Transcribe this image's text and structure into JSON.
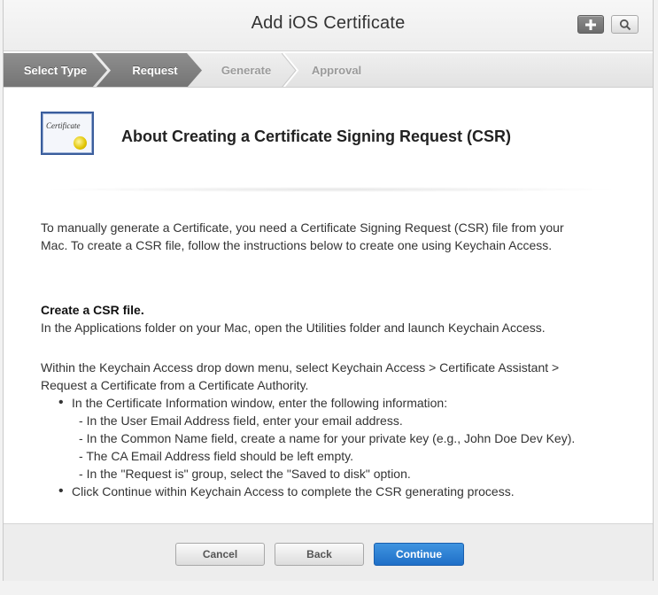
{
  "window": {
    "title": "Add iOS Certificate"
  },
  "toolbar": {
    "add_icon": "plus-icon",
    "search_icon": "search-icon"
  },
  "steps": [
    {
      "label": "Select Type",
      "state": "complete"
    },
    {
      "label": "Request",
      "state": "current"
    },
    {
      "label": "Generate",
      "state": "upcoming"
    },
    {
      "label": "Approval",
      "state": "upcoming"
    }
  ],
  "header": {
    "image_text": "Certificate",
    "title": "About Creating a Certificate Signing Request (CSR)"
  },
  "content": {
    "intro_1": "To manually generate a Certificate, you need a Certificate Signing Request (CSR) file from your",
    "intro_2": "Mac. To create a CSR file, follow the instructions below to create one using Keychain Access.",
    "section_title": "Create a CSR file.",
    "section_text": "In the Applications folder on your Mac, open the Utilities folder and launch Keychain Access.",
    "menu_text_1": "Within the Keychain Access drop down menu, select Keychain Access > Certificate Assistant >",
    "menu_text_2": "Request a Certificate from a Certificate Authority.",
    "bullet_1": "In the Certificate Information window, enter the following information:",
    "sub_bullets": [
      "In the User Email Address field, enter your email address.",
      "In the Common Name field, create a name for your private key (e.g., John Doe Dev Key).",
      "The CA Email Address field should be left empty.",
      "In the \"Request is\" group, select the \"Saved to disk\" option."
    ],
    "bullet_2": "Click Continue within Keychain Access to complete the CSR generating process."
  },
  "footer": {
    "cancel_label": "Cancel",
    "back_label": "Back",
    "continue_label": "Continue"
  },
  "colors": {
    "accent_blue": "#2a7fd4",
    "active_step": "#7f7f7f",
    "inactive_step_text": "#9a9a9a"
  }
}
